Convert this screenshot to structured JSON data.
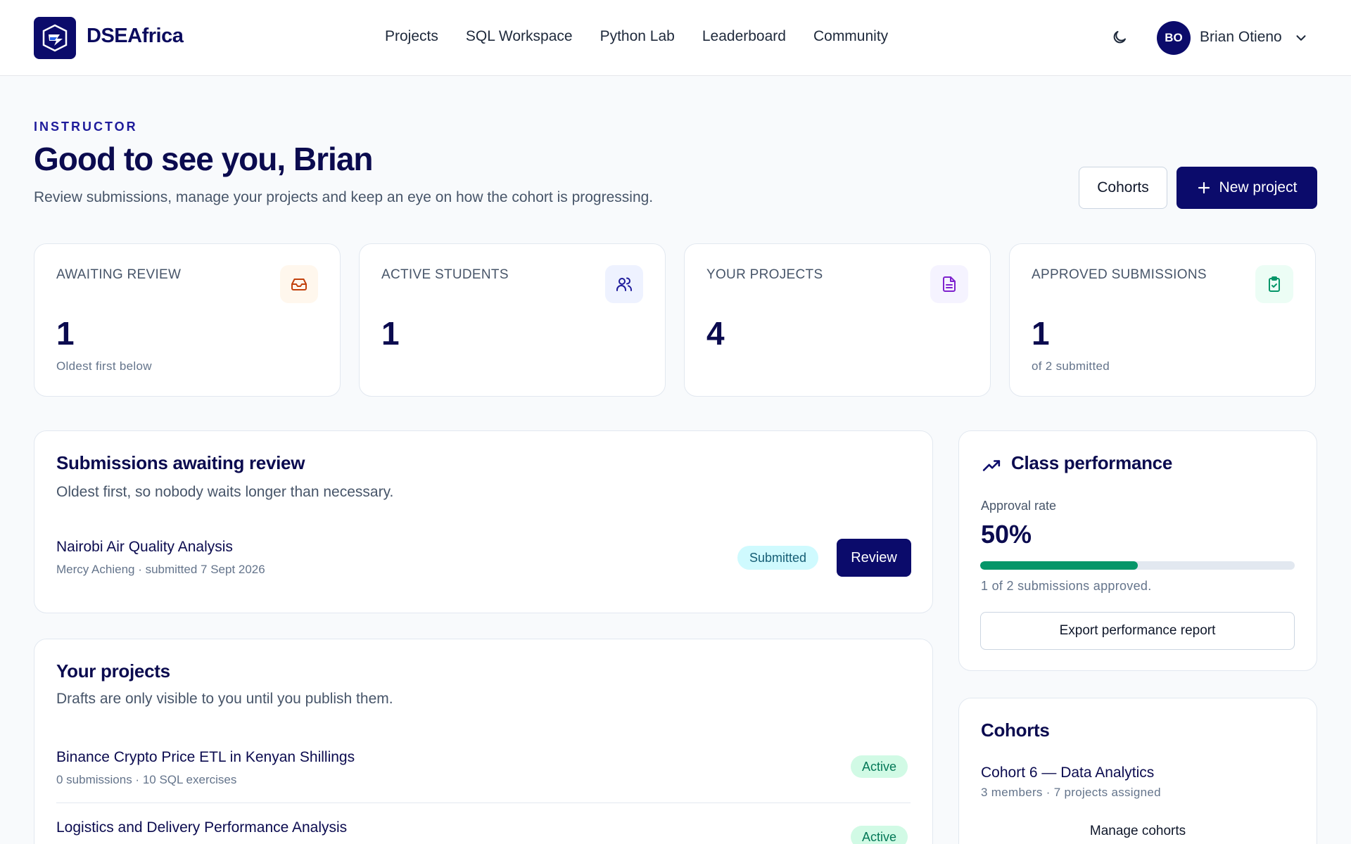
{
  "brand": {
    "name": "DSEAfrica",
    "logo_icon": "shield-logo-icon"
  },
  "nav": {
    "items": [
      "Projects",
      "SQL Workspace",
      "Python Lab",
      "Leaderboard",
      "Community"
    ]
  },
  "user": {
    "initials": "BO",
    "name": "Brian Otieno"
  },
  "header": {
    "eyebrow": "INSTRUCTOR",
    "title": "Good to see you, Brian",
    "subtitle": "Review submissions, manage your projects and keep an eye on how the cohort is progressing.",
    "cohorts_button": "Cohorts",
    "new_project_button": "New project"
  },
  "stats": [
    {
      "label": "AWAITING REVIEW",
      "value": "1",
      "hint": "Oldest first below",
      "icon": "inbox-icon",
      "color": "#c2410c",
      "bg": "#fff7ed"
    },
    {
      "label": "ACTIVE STUDENTS",
      "value": "1",
      "hint": "",
      "icon": "users-icon",
      "color": "#1e1b9b",
      "bg": "#eef2ff"
    },
    {
      "label": "YOUR PROJECTS",
      "value": "4",
      "hint": "",
      "icon": "file-text-icon",
      "color": "#7e22ce",
      "bg": "#f5f3ff"
    },
    {
      "label": "APPROVED SUBMISSIONS",
      "value": "1",
      "hint": "of 2 submitted",
      "icon": "clipboard-check-icon",
      "color": "#059669",
      "bg": "#ecfdf5"
    }
  ],
  "awaiting": {
    "title": "Submissions awaiting review",
    "subtitle": "Oldest first, so nobody waits longer than necessary.",
    "items": [
      {
        "title": "Nairobi Air Quality Analysis",
        "meta": "Mercy Achieng · submitted 7 Sept 2026",
        "status": "Submitted",
        "action": "Review"
      }
    ]
  },
  "projects": {
    "title": "Your projects",
    "subtitle": "Drafts are only visible to you until you publish them.",
    "items": [
      {
        "title": "Binance Crypto Price ETL in Kenyan Shillings",
        "meta": "0 submissions · 10 SQL exercises",
        "status": "Active"
      },
      {
        "title": "Logistics and Delivery Performance Analysis",
        "meta": "",
        "status": "Active"
      }
    ]
  },
  "performance": {
    "title": "Class performance",
    "icon": "trending-up-icon",
    "label": "Approval rate",
    "value": "50%",
    "progress": 0.5,
    "caption": "1 of 2 submissions approved.",
    "export_button": "Export performance report"
  },
  "cohorts": {
    "title": "Cohorts",
    "items": [
      {
        "name": "Cohort 6 — Data Analytics",
        "meta": "3 members · 7 projects assigned"
      }
    ],
    "manage_link": "Manage cohorts"
  },
  "colors": {
    "brand": "#0b0b6b",
    "accent_green": "#059669"
  }
}
